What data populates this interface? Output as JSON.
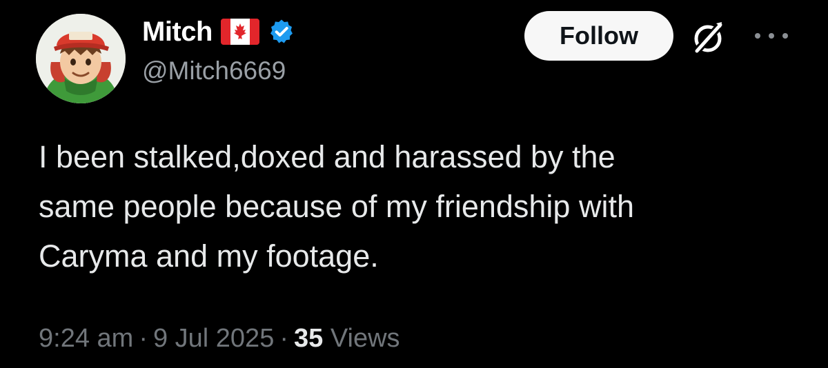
{
  "tweet": {
    "author": {
      "display_name": "Mitch",
      "handle": "@Mitch6669",
      "flag_icon": "canada-flag-icon",
      "verified_icon": "verified-badge-icon",
      "verified_color": "#1d9bf0"
    },
    "actions": {
      "follow_label": "Follow",
      "grok_icon": "grok-icon",
      "more_icon": "more-options-icon"
    },
    "text_lines": [
      "I been stalked,doxed and harassed by the",
      "same people because of my friendship with",
      "Caryma and my footage."
    ],
    "meta": {
      "time": "9:24 am",
      "separator": "·",
      "date": "9 Jul 2025",
      "views_count": "35",
      "views_label": "Views"
    }
  },
  "colors": {
    "background": "#000000",
    "primary_text": "#e7e9ea",
    "secondary_text": "#71767b",
    "follow_button_bg": "#f7f7f7"
  }
}
